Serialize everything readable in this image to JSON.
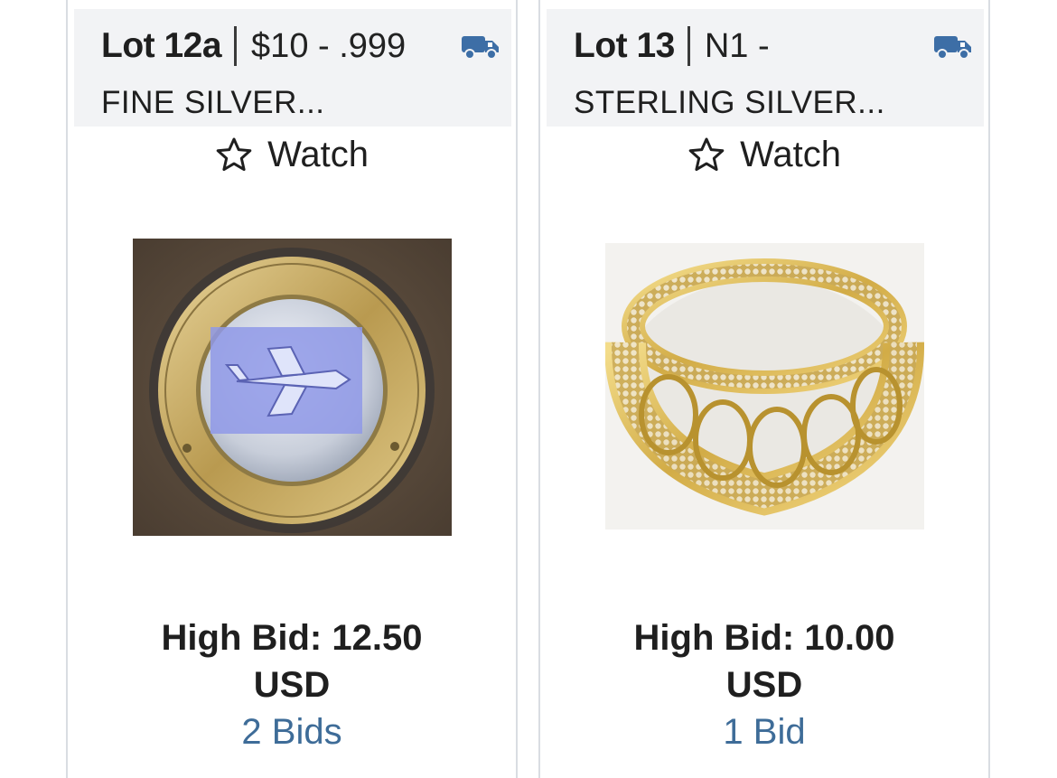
{
  "lots": [
    {
      "lot_number": "Lot 12a",
      "category": "$10 - .999",
      "title": "FINE SILVER...",
      "watch_label": "Watch",
      "image": "silver gaming token coin",
      "high_bid_line1": "High Bid: 12.50",
      "high_bid_line2": "USD",
      "bids": "2 Bids"
    },
    {
      "lot_number": "Lot 13",
      "category": "N1 -",
      "title": "STERLING SILVER...",
      "watch_label": "Watch",
      "image": "gold cuban link ring",
      "high_bid_line1": "High Bid: 10.00",
      "high_bid_line2": "USD",
      "bids": "1 Bid"
    }
  ],
  "icons": {
    "shipping": "truck-icon",
    "watch": "star-outline-icon"
  },
  "colors": {
    "header_bg": "#f2f3f5",
    "link": "#3e6c98",
    "truck": "#3d6ea6",
    "border": "#d9dde2"
  }
}
